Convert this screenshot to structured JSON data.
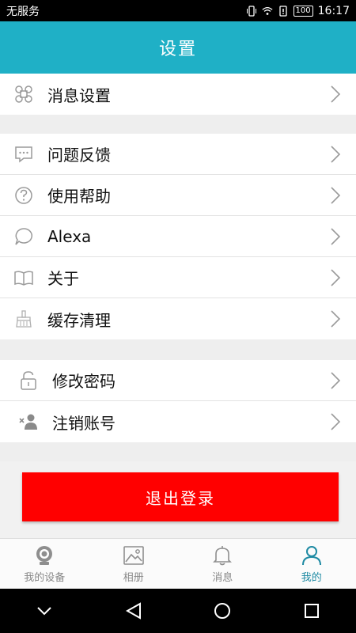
{
  "status_bar": {
    "carrier": "无服务",
    "battery": "100",
    "time": "16:17"
  },
  "header": {
    "title": "设置"
  },
  "groups": [
    {
      "items": [
        {
          "label": "消息设置",
          "icon": "command-icon"
        }
      ]
    },
    {
      "items": [
        {
          "label": "问题反馈",
          "icon": "chat-icon"
        },
        {
          "label": "使用帮助",
          "icon": "help-icon"
        },
        {
          "label": "Alexa",
          "icon": "speech-bubble-icon"
        },
        {
          "label": "关于",
          "icon": "book-icon"
        },
        {
          "label": "缓存清理",
          "icon": "broom-icon"
        }
      ]
    },
    {
      "items": [
        {
          "label": "修改密码",
          "icon": "unlock-icon"
        },
        {
          "label": "注销账号",
          "icon": "remove-user-icon"
        }
      ]
    }
  ],
  "logout_label": "退出登录",
  "tabs": [
    {
      "label": "我的设备",
      "icon": "camera-icon",
      "active": false
    },
    {
      "label": "相册",
      "icon": "image-icon",
      "active": false
    },
    {
      "label": "消息",
      "icon": "bell-icon",
      "active": false
    },
    {
      "label": "我的",
      "icon": "person-icon",
      "active": true
    }
  ],
  "colors": {
    "header": "#1fb0c6",
    "logout": "#ff0000",
    "active_tab": "#1e8aa3"
  }
}
